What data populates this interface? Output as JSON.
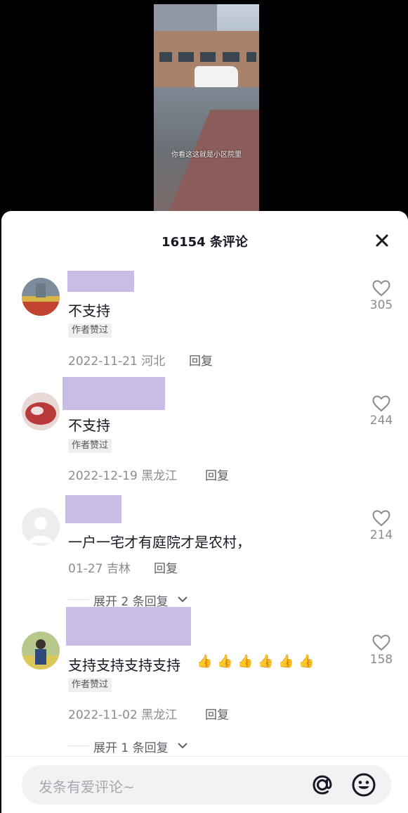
{
  "video": {
    "caption": "你看这这就是小区院里"
  },
  "sheet": {
    "title": "16154 条评论",
    "close_icon": "close-icon"
  },
  "comments": [
    {
      "text": "不支持",
      "badge": "作者赞过",
      "date": "2022-11-21",
      "region": "河北",
      "reply_label": "回复",
      "like_count": "305"
    },
    {
      "text": "不支持",
      "badge": "作者赞过",
      "date": "2022-12-19",
      "region": "黑龙江",
      "reply_label": "回复",
      "like_count": "244"
    },
    {
      "text": "一户一宅才有庭院才是农村，",
      "date": "01-27",
      "region": "吉林",
      "reply_label": "回复",
      "like_count": "214",
      "expand_label": "展开 2 条回复"
    },
    {
      "text": "支持支持支持支持",
      "emoji": "👍",
      "badge": "作者赞过",
      "date": "2022-11-02",
      "region": "黑龙江",
      "reply_label": "回复",
      "like_count": "158",
      "expand_label": "展开 1 条回复"
    }
  ],
  "input": {
    "placeholder": "发条有爱评论~",
    "at_icon": "at-icon",
    "emoji_icon": "emoji-icon"
  },
  "colors": {
    "name_redaction": "#c9bde8",
    "text": "#161823",
    "muted": "#8a8b91"
  }
}
